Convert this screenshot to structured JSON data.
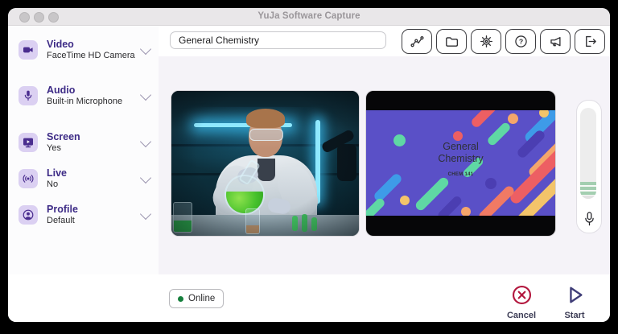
{
  "window": {
    "title": "YuJa Software Capture"
  },
  "sidebar": {
    "items": [
      {
        "label": "Video",
        "value": "FaceTime HD Camera",
        "icon": "camera-icon"
      },
      {
        "label": "Audio",
        "value": "Built-in Microphone",
        "icon": "microphone-icon"
      },
      {
        "label": "Screen",
        "value": "Yes",
        "icon": "screen-play-icon"
      },
      {
        "label": "Live",
        "value": "No",
        "icon": "broadcast-icon"
      },
      {
        "label": "Profile",
        "value": "Default",
        "icon": "profile-icon"
      }
    ]
  },
  "topbar": {
    "session_title": "General Chemistry",
    "buttons": [
      "analytics-icon",
      "folder-icon",
      "settings-gear-icon",
      "help-icon",
      "megaphone-icon",
      "logout-icon"
    ]
  },
  "previews": {
    "camera": {
      "name": "camera-preview"
    },
    "screen_slide": {
      "title_line1": "General",
      "title_line2": "Chemistry",
      "subtitle": "CHEM 141"
    }
  },
  "footer": {
    "online_label": "Online",
    "cancel_label": "Cancel",
    "start_label": "Start"
  },
  "colors": {
    "accent_purple": "#4A2D8F",
    "icon_tile_purple": "#DBD0F2",
    "cancel_red": "#B3173E",
    "start_navy": "#3F3D77",
    "online_green": "#157F3C",
    "slide_background": "#5A50C7",
    "meter_green": "#A3CEB0",
    "stage_background": "#F5F3F8"
  }
}
